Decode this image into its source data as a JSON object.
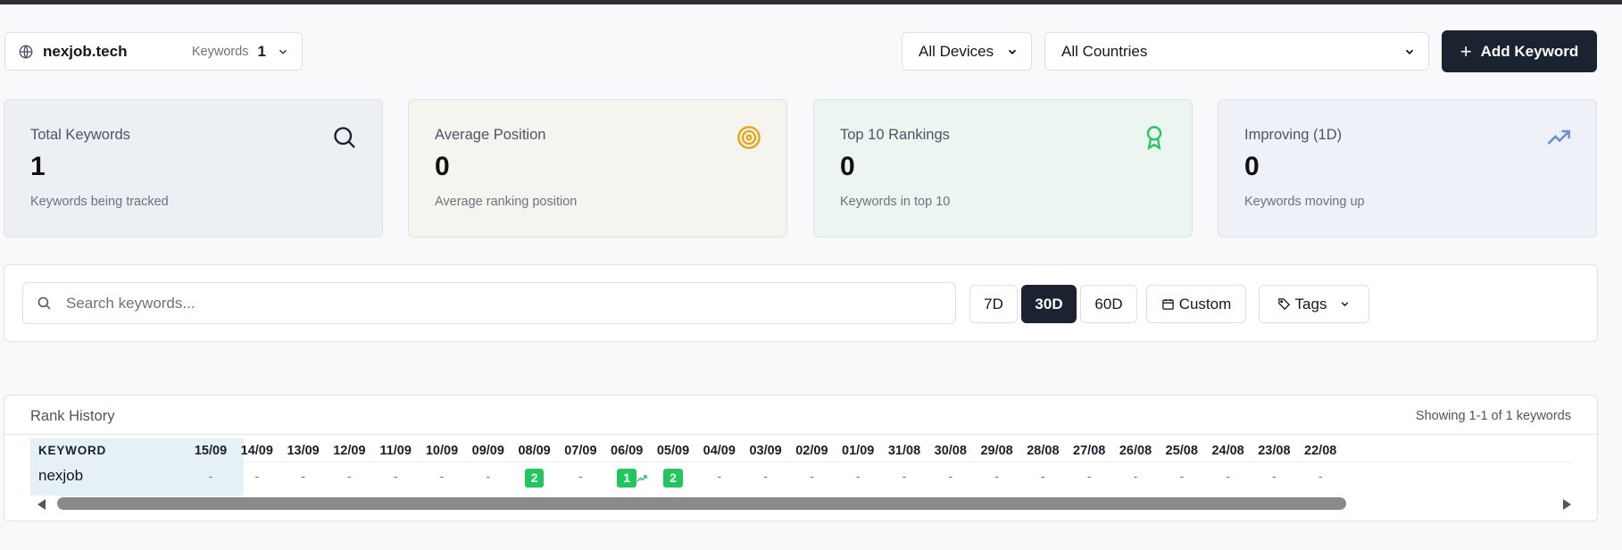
{
  "header": {
    "domain": "nexjob.tech",
    "keywords_label": "Keywords",
    "keywords_count": "1",
    "devices": "All Devices",
    "countries": "All Countries",
    "add_button": "Add Keyword"
  },
  "stats": [
    {
      "title": "Total Keywords",
      "value": "1",
      "sub": "Keywords being tracked",
      "icon": "search-icon",
      "color": "#1a1f2b"
    },
    {
      "title": "Average Position",
      "value": "0",
      "sub": "Average ranking position",
      "icon": "target-icon",
      "color": "#e6a417"
    },
    {
      "title": "Top 10 Rankings",
      "value": "0",
      "sub": "Keywords in top 10",
      "icon": "award-icon",
      "color": "#22c55e"
    },
    {
      "title": "Improving (1D)",
      "value": "0",
      "sub": "Keywords moving up",
      "icon": "trending-up-icon",
      "color": "#6b8fd6"
    }
  ],
  "filters": {
    "search_placeholder": "Search keywords...",
    "ranges": [
      "7D",
      "30D",
      "60D"
    ],
    "active_range": "30D",
    "custom": "Custom",
    "tags": "Tags"
  },
  "history": {
    "title": "Rank History",
    "showing": "Showing 1-1 of 1 keywords",
    "keyword_header": "KEYWORD",
    "dates": [
      "15/09",
      "14/09",
      "13/09",
      "12/09",
      "11/09",
      "10/09",
      "09/09",
      "08/09",
      "07/09",
      "06/09",
      "05/09",
      "04/09",
      "03/09",
      "02/09",
      "01/09",
      "31/08",
      "30/08",
      "29/08",
      "28/08",
      "27/08",
      "26/08",
      "25/08",
      "24/08",
      "23/08",
      "22/08"
    ],
    "rows": [
      {
        "keyword": "nexjob",
        "values": [
          "-",
          "-",
          "-",
          "-",
          "-",
          "-",
          "-",
          "2",
          "-",
          "1",
          "2",
          "-",
          "-",
          "-",
          "-",
          "-",
          "-",
          "-",
          "-",
          "-",
          "-",
          "-",
          "-",
          "-",
          "-"
        ],
        "trend_up_index": 9
      }
    ],
    "badge_color": "#22c55e"
  }
}
